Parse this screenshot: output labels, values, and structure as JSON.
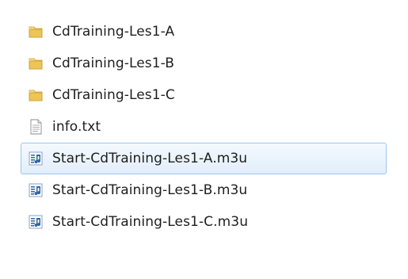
{
  "files": [
    {
      "name": "CdTraining-Les1-A",
      "type": "folder",
      "icon": "folder-icon",
      "selected": false
    },
    {
      "name": "CdTraining-Les1-B",
      "type": "folder",
      "icon": "folder-icon",
      "selected": false
    },
    {
      "name": "CdTraining-Les1-C",
      "type": "folder",
      "icon": "folder-icon",
      "selected": false
    },
    {
      "name": "info.txt",
      "type": "text-file",
      "icon": "text-file-icon",
      "selected": false
    },
    {
      "name": "Start-CdTraining-Les1-A.m3u",
      "type": "playlist-file",
      "icon": "playlist-file-icon",
      "selected": true
    },
    {
      "name": "Start-CdTraining-Les1-B.m3u",
      "type": "playlist-file",
      "icon": "playlist-file-icon",
      "selected": false
    },
    {
      "name": "Start-CdTraining-Les1-C.m3u",
      "type": "playlist-file",
      "icon": "playlist-file-icon",
      "selected": false
    }
  ],
  "colors": {
    "selection_border": "#9cc6ee",
    "selection_fill": "#e2eefb",
    "folder": "#e8c25a",
    "text": "#1e1e1e"
  }
}
